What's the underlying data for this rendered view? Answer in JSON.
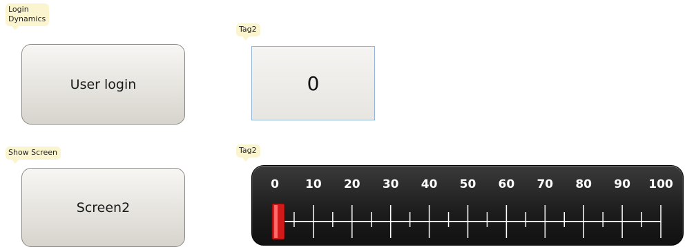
{
  "login": {
    "callout_text": "Login\nDynamics",
    "button_label": "User login"
  },
  "tag_field": {
    "callout_text": "Tag2",
    "value": "0"
  },
  "screen_nav": {
    "callout_text": "Show Screen",
    "button_label": "Screen2"
  },
  "bar": {
    "callout_text": "Tag2",
    "min": 0,
    "max": 100,
    "current_value": 0,
    "tick_labels": [
      "0",
      "10",
      "20",
      "30",
      "40",
      "50",
      "60",
      "70",
      "80",
      "90",
      "100"
    ],
    "fill_color": "#d31a1a"
  }
}
